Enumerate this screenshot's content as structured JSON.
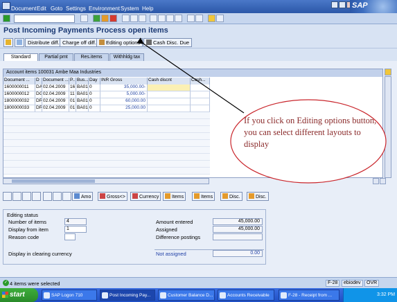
{
  "menubar": {
    "items": [
      "Document",
      "Edit",
      "Goto",
      "Settings",
      "Environment",
      "System",
      "Help"
    ],
    "logo": "SAP"
  },
  "page_title": "Post Incoming Payments Process open items",
  "app_toolbar": {
    "distribute": "Distribute diff.",
    "charge_off": "Charge off diff.",
    "editing_options": "Editing options",
    "cash_disc_due": "Cash Disc. Due"
  },
  "tabs": [
    "Standard",
    "Partial pmt",
    "Res.items",
    "Withhldg tax"
  ],
  "grid": {
    "title": "Account items 100031 Ambe Maa Industries",
    "columns": [
      "Document ...",
      "D",
      "Document ...",
      "P..",
      "Bus...",
      "Day",
      "INR Gross",
      "Cash discnt",
      "Cash..."
    ],
    "rows": [
      [
        "1600000011",
        "DA",
        "02.04.2009",
        "16",
        "BA01",
        "0",
        "35,000.00-",
        ""
      ],
      [
        "1600000012",
        "DG",
        "02.04.2009",
        "11",
        "BA01",
        "0",
        "5,000.00-",
        ""
      ],
      [
        "1800000032",
        "DR",
        "02.04.2009",
        "01",
        "BA01",
        "0",
        "60,000.00",
        ""
      ],
      [
        "1800000033",
        "DR",
        "02.04.2009",
        "01",
        "BA01",
        "0",
        "25,000.00",
        ""
      ]
    ]
  },
  "bottom_buttons": {
    "amo": "Amo",
    "gross": "Gross<>",
    "currency": "Currency",
    "items1": "Items",
    "items2": "Items",
    "disc1": "Disc.",
    "disc2": "Disc."
  },
  "editing_status": {
    "title": "Editing status",
    "num_items_label": "Number of items",
    "num_items_value": "4",
    "display_from_label": "Display from item",
    "display_from_value": "1",
    "reason_code_label": "Reason code",
    "display_clearing_label": "Display in clearing currency",
    "amount_entered_label": "Amount entered",
    "amount_entered_value": "45,000.00",
    "assigned_label": "Assigned",
    "assigned_value": "45,000.00",
    "difference_label": "Difference postings",
    "not_assigned_label": "Not assigned",
    "not_assigned_value": "0.00"
  },
  "status": {
    "message": "4 items were selected",
    "tcode": "F-28",
    "server": "ebiodev",
    "mode": "OVR"
  },
  "taskbar": {
    "start": "start",
    "tasks": [
      "SAP Logon 710",
      "Post Incoming Pay...",
      "Customer Balance D...",
      "Accounts Receivable",
      "F-28 - Receipt from ..."
    ],
    "time": "3:32 PM"
  },
  "callout": {
    "text": "If you click on Editing options button, you can select different layouts to display"
  },
  "colors": {
    "menubar": "#2b57a8",
    "callout_border": "#c9252b",
    "callout_text": "#8a2a2a"
  }
}
